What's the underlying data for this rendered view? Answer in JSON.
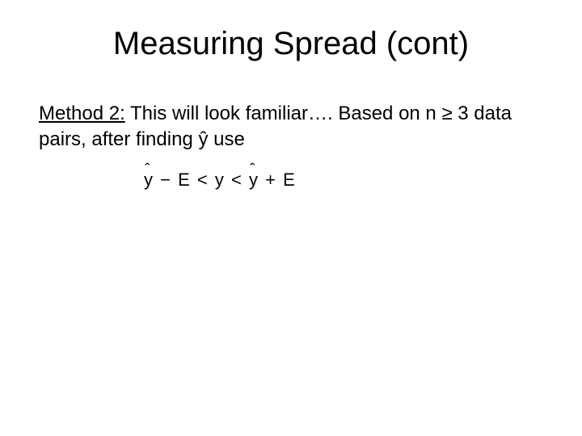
{
  "title": "Measuring Spread (cont)",
  "method_label": "Method 2:",
  "body_after_label": "  This will look familiar….  Based on n ≥ 3 data pairs, after finding ŷ use",
  "formula": {
    "lhs_var": "y",
    "lhs_minus": "−",
    "lhs_E": "E",
    "lt1": "<",
    "mid": "y",
    "lt2": "<",
    "rhs_var": "y",
    "rhs_plus": "+",
    "rhs_E": "E"
  }
}
